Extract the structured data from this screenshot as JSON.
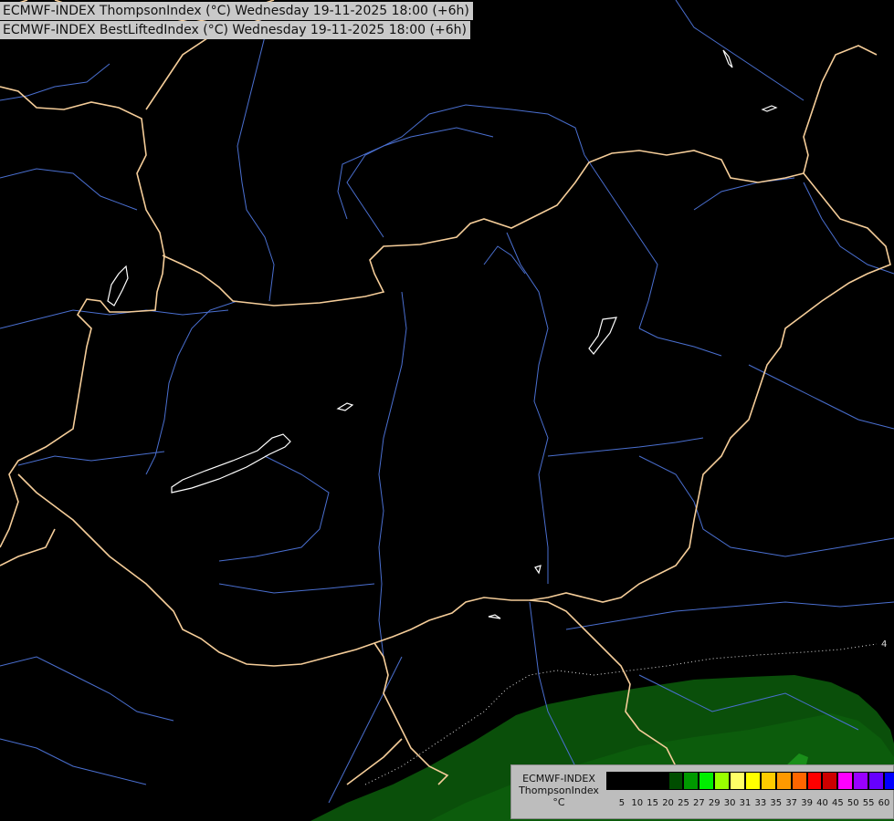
{
  "titles": {
    "line1": "ECMWF-INDEX ThompsonIndex (°C) Wednesday 19-11-2025 18:00 (+6h)",
    "line2": "ECMWF-INDEX BestLiftedIndex (°C) Wednesday 19-11-2025 18:00 (+6h)"
  },
  "legend": {
    "line1": "ECMWF-INDEX",
    "line2": "ThompsonIndex",
    "line3": "°C",
    "ticks": [
      "5",
      "10",
      "15",
      "20",
      "25",
      "27",
      "29",
      "30",
      "31",
      "33",
      "35",
      "37",
      "39",
      "40",
      "45",
      "50",
      "55",
      "60"
    ],
    "colors": [
      "#000000",
      "#000000",
      "#000000",
      "#000000",
      "#004d00",
      "#009900",
      "#00ee00",
      "#99ff00",
      "#ffff66",
      "#ffff00",
      "#ffcc00",
      "#ff9900",
      "#ff6600",
      "#ff0000",
      "#cc0000",
      "#ff00ff",
      "#9900ff",
      "#6600ff",
      "#0000ff"
    ]
  },
  "isoline_label": "4",
  "colors": {
    "background": "#000000",
    "border": "#f5cd99",
    "river": "#4a6fd0",
    "lake": "#ffffff",
    "field_dark": "#0a4f0a",
    "field_mid": "#137a13"
  }
}
